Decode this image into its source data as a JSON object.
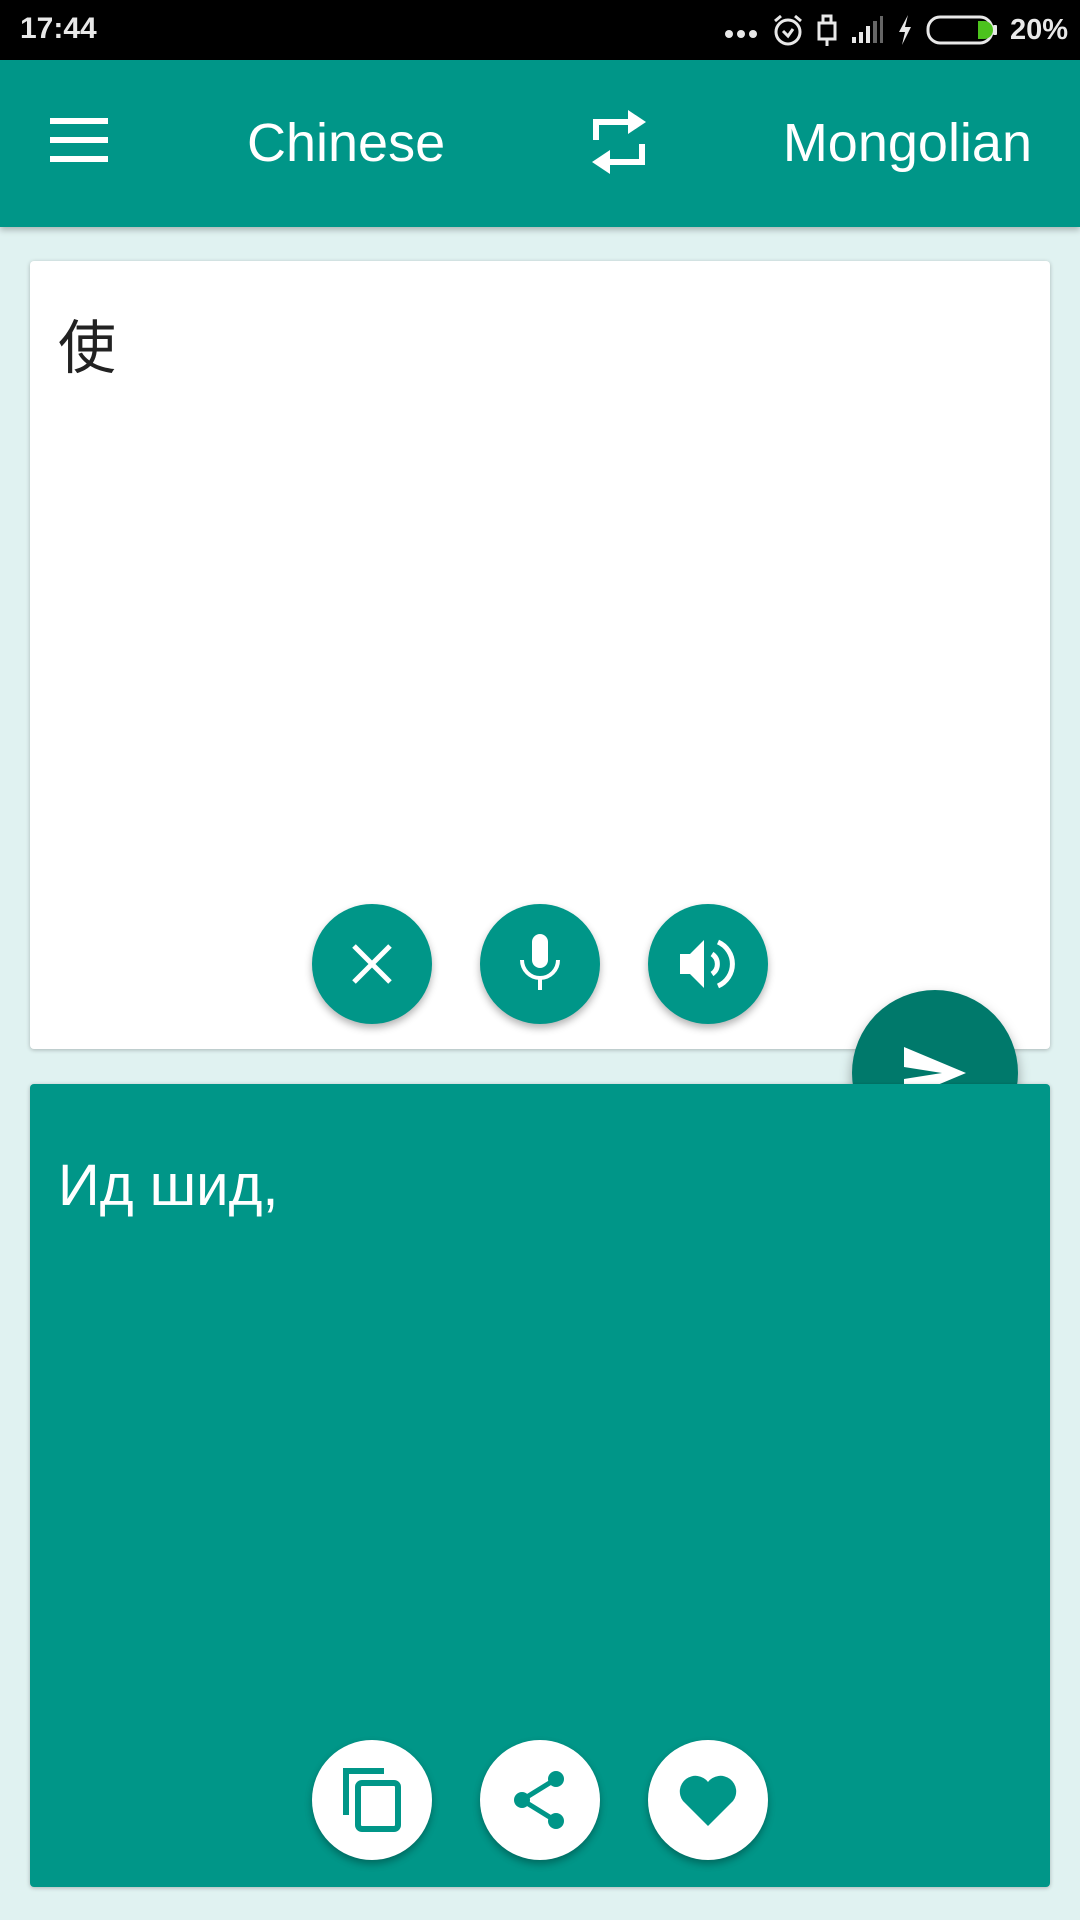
{
  "status_bar": {
    "time": "17:44",
    "battery_percent": "20%",
    "battery_level": 0.2,
    "icons": [
      "more-dots-icon",
      "alarm-icon",
      "usb-icon",
      "signal-icon",
      "charging-icon",
      "battery-icon"
    ]
  },
  "toolbar": {
    "menu_icon": "hamburger-menu-icon",
    "source_language": "Chinese",
    "swap_icon": "swap-arrows-icon",
    "target_language": "Mongolian"
  },
  "input_card": {
    "text": "使",
    "buttons": [
      {
        "name": "clear",
        "icon": "close-icon"
      },
      {
        "name": "voice-input",
        "icon": "microphone-icon"
      },
      {
        "name": "speak",
        "icon": "speaker-icon"
      }
    ]
  },
  "translate_button": {
    "icon": "send-icon"
  },
  "output_card": {
    "text": "Ид шид,",
    "buttons": [
      {
        "name": "copy",
        "icon": "copy-icon"
      },
      {
        "name": "share",
        "icon": "share-icon"
      },
      {
        "name": "favorite",
        "icon": "heart-icon"
      }
    ]
  },
  "colors": {
    "primary": "#009688",
    "primary_dark": "#00796b",
    "background": "#e0f2f1",
    "battery_green": "#4cc31d"
  }
}
